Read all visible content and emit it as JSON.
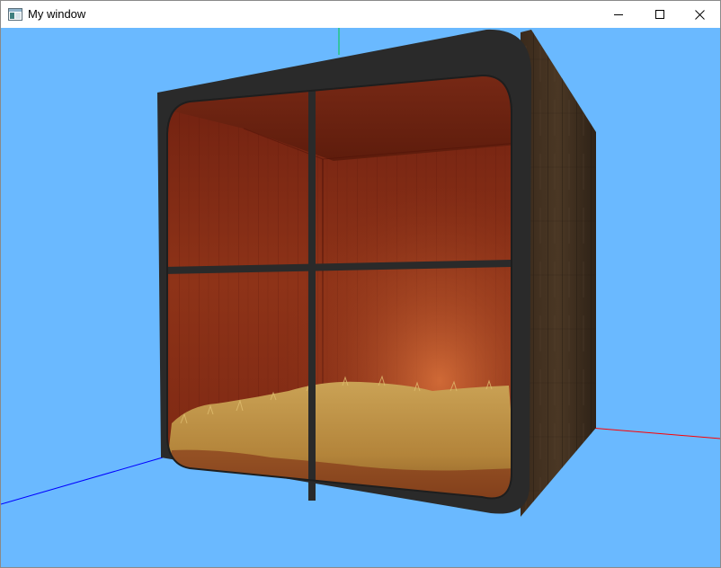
{
  "window": {
    "title": "My window",
    "controls": {
      "minimize_icon": "minimize-icon",
      "maximize_icon": "maximize-icon",
      "close_icon": "close-icon"
    }
  },
  "scene": {
    "background_color": "#6ab9ff",
    "axis_colors": {
      "x": "#ff0000",
      "y": "#00cc44",
      "z": "#0000ff"
    },
    "frame_color": "#2a2a2a",
    "interior_wood_color": "#8a2a14",
    "exterior_wood_color": "#3d2b1c",
    "grass_color": "#b98a3a"
  }
}
